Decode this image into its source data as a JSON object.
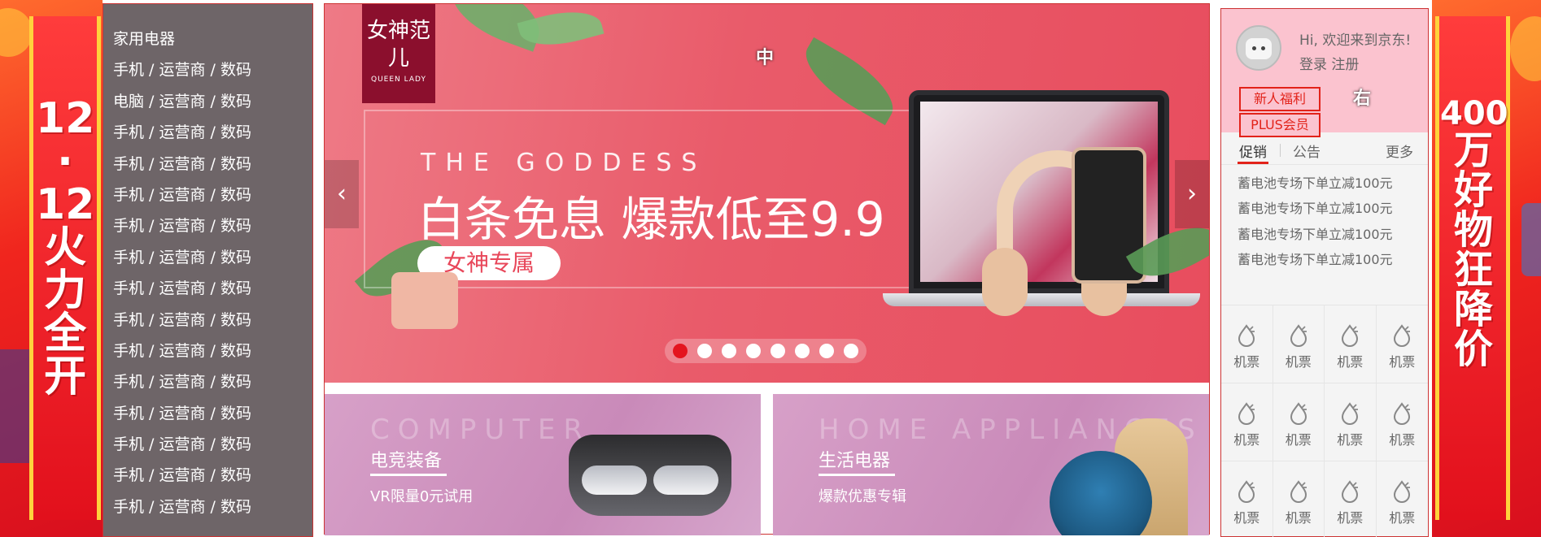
{
  "left_banner": {
    "text_lines": [
      "12",
      "·",
      "12",
      "火",
      "力",
      "全",
      "开"
    ]
  },
  "right_banner": {
    "text_lines": [
      "400",
      "万",
      "好",
      "物",
      "狂",
      "降",
      "价"
    ]
  },
  "category_menu": {
    "items": [
      "家用电器",
      "手机 / 运营商 / 数码",
      "电脑 / 运营商 / 数码",
      "手机 / 运营商 / 数码",
      "手机 / 运营商 / 数码",
      "手机 / 运营商 / 数码",
      "手机 / 运营商 / 数码",
      "手机 / 运营商 / 数码",
      "手机 / 运营商 / 数码",
      "手机 / 运营商 / 数码",
      "手机 / 运营商 / 数码",
      "手机 / 运营商 / 数码",
      "手机 / 运营商 / 数码",
      "手机 / 运营商 / 数码",
      "手机 / 运营商 / 数码",
      "手机 / 运营商 / 数码"
    ]
  },
  "carousel": {
    "brand_name": "女神范儿",
    "brand_sub": "QUEEN LADY",
    "headline_en": "THE GODDESS",
    "headline": "白条免息 爆款低至9.9",
    "pill": "女神专属",
    "region_label": "中",
    "prev_arrow": "‹",
    "next_arrow": "›",
    "dot_count": 8,
    "active_dot": 0
  },
  "sub_banners": [
    {
      "en": "COMPUTER",
      "title": "电竞装备",
      "desc": "VR限量0元试用"
    },
    {
      "en": "HOME APPLIANCES",
      "title": "生活电器",
      "desc": "爆款优惠专辑"
    }
  ],
  "user_panel": {
    "greeting": "Hi, 欢迎来到京东!",
    "login": "登录",
    "register": "注册",
    "new_user_button": "新人福利",
    "plus_button": "PLUS会员",
    "region_label": "右"
  },
  "news": {
    "tabs": [
      "促销",
      "公告"
    ],
    "more": "更多",
    "items": [
      "蓄电池专场下单立减100元",
      "蓄电池专场下单立减100元",
      "蓄电池专场下单立减100元",
      "蓄电池专场下单立减100元"
    ]
  },
  "services": {
    "items": [
      "机票",
      "机票",
      "机票",
      "机票",
      "机票",
      "机票",
      "机票",
      "机票",
      "机票",
      "机票",
      "机票",
      "机票"
    ]
  },
  "colors": {
    "accent": "#e2231a",
    "menu_bg": "#6e6568",
    "user_box_bg": "#fbc3cf"
  }
}
